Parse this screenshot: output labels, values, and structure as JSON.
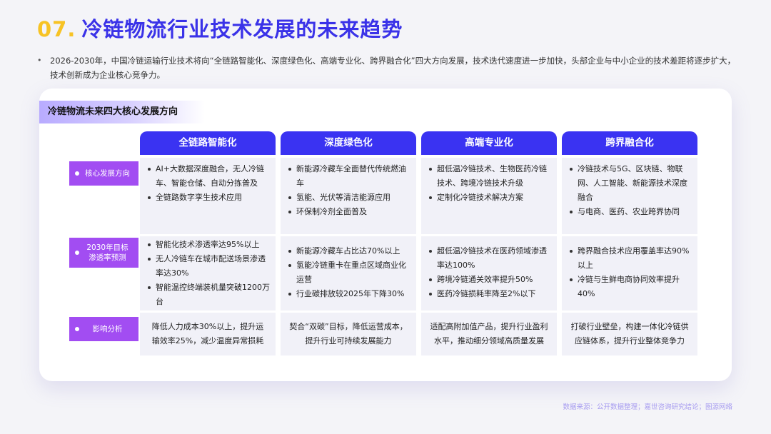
{
  "page": {
    "number": "07.",
    "title": "冷链物流行业技术发展的未来趋势",
    "bullet": "2026-2030年，中国冷链运输行业技术将向“全链路智能化、深度绿色化、高端专业化、跨界融合化”四大方向发展，技术迭代速度进一步加快，头部企业与中小企业的技术差距将逐步扩大，技术创新成为企业核心竞争力。",
    "source": "数据来源：公开数据整理；嘉世咨询研究结论；图源网络"
  },
  "card": {
    "heading": "冷链物流未来四大核心发展方向",
    "columns": [
      "全链路智能化",
      "深度绿色化",
      "高端专业化",
      "跨界融合化"
    ],
    "row_labels": [
      "核心发展方向",
      "2030年目标\n渗透率预测",
      "影响分析"
    ],
    "rows": {
      "direction": [
        [
          "AI+大数据深度融合，无人冷链车、智能仓储、自动分拣普及",
          "全链路数字孪生技术应用"
        ],
        [
          "新能源冷藏车全面替代传统燃油车",
          "氢能、光伏等清洁能源应用",
          "环保制冷剂全面普及"
        ],
        [
          "超低温冷链技术、生物医药冷链技术、跨境冷链技术升级",
          "定制化冷链技术解决方案"
        ],
        [
          "冷链技术与5G、区块链、物联网、人工智能、新能源技术深度融合",
          "与电商、医药、农业跨界协同"
        ]
      ],
      "target": [
        [
          "智能化技术渗透率达95%以上",
          "无人冷链车在城市配送场景渗透率达30%",
          "智能温控终端装机量突破1200万台"
        ],
        [
          "新能源冷藏车占比达70%以上",
          "氢能冷链重卡在重点区域商业化运营",
          "行业碳排放较2025年下降30%"
        ],
        [
          "超低温冷链技术在医药领域渗透率达100%",
          "跨境冷链通关效率提升50%",
          "医药冷链损耗率降至2%以下"
        ],
        [
          "跨界融合技术应用覆盖率达90%以上",
          "冷链与生鲜电商协同效率提升40%"
        ]
      ],
      "impact": [
        "降低人力成本30%以上，提升运输效率25%，减少温度异常损耗",
        "契合“双碳”目标，降低运营成本，提升行业可持续发展能力",
        "适配高附加值产品，提升行业盈利水平，推动细分领域高质量发展",
        "打破行业壁垒，构建一体化冷链供应链体系，提升行业整体竞争力"
      ]
    }
  }
}
